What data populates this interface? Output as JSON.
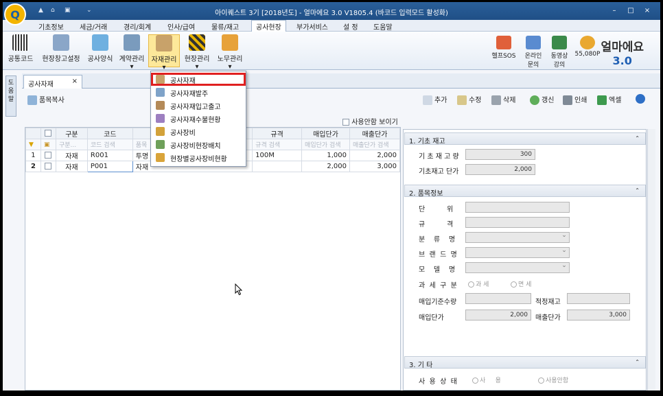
{
  "title": "아이퀘스트 3기 [2018년도] - 얼마에요 3.0 V1805.4 (바코드 입력모드 활성화)",
  "quick_access": [
    "▲",
    "⌂",
    "▣",
    "⌄"
  ],
  "window_buttons": [
    "–",
    "□",
    "×"
  ],
  "menu": [
    "기초정보",
    "세금/거래",
    "경리/회계",
    "인사/급여",
    "물류/재고",
    "공사현장",
    "부가서비스",
    "설 정",
    "도움말"
  ],
  "ribbon": {
    "buttons": [
      "공통코드",
      "현장창고설정",
      "공사양식",
      "계약관리",
      "자재관리",
      "현장관리",
      "노무관리"
    ],
    "arrows": [
      "▾",
      "▾",
      "▾",
      "▾"
    ],
    "right": [
      "헬프SOS",
      "온라인",
      "문의",
      "동영상",
      "강의",
      "55,080P"
    ],
    "brand_line1": "얼마에요",
    "brand_line2": "3.0"
  },
  "sidebar_text": "도움말",
  "doc_tab": {
    "label": "공사자재",
    "close": "×"
  },
  "toolbar": {
    "left": "품목복사",
    "buttons": [
      "추가",
      "수정",
      "삭제",
      "갱신",
      "인쇄",
      "엑셀"
    ]
  },
  "show_unused": "사용안함 보이기",
  "grid": {
    "headers": [
      "",
      "구분",
      "코드",
      "품목",
      "규격",
      "매입단가",
      "매출단가"
    ],
    "filters": [
      "",
      "구분...",
      "코드 검색",
      "품목",
      "규격 검색",
      "매입단가 검색",
      "매출단가 검색"
    ],
    "rows": [
      {
        "no": "1",
        "type": "자재",
        "code": "R001",
        "name": "투명",
        "spec": "100M",
        "buy": "1,000",
        "sell": "2,000"
      },
      {
        "no": "2",
        "type": "자재",
        "code": "P001",
        "name": "자재",
        "spec": "",
        "buy": "2,000",
        "sell": "3,000"
      }
    ]
  },
  "panel": {
    "sec1": "1. 기초 재고",
    "stock_qty_label": "기 초 재 고 량",
    "stock_qty": "300",
    "stock_price_label": "기초재고 단가",
    "stock_price": "2,000",
    "sec2": "2. 품목정보",
    "unit_label": "단          위",
    "spec_label": "규          격",
    "cat_label": "분    류    명",
    "brand_label": "브  랜  드  명",
    "model_label": "모    델    명",
    "tax_label": "과  세  구  분",
    "tax_opt1": "과 세",
    "tax_opt2": "면 세",
    "base_qty_label": "매입기준수량",
    "proper_stock_label": "적정재고",
    "buy_label": "매입단가",
    "buy_price": "2,000",
    "sell_label": "매출단가",
    "sell_price": "3,000",
    "sec3": "3. 기 타",
    "use_label": "사  용  상  태",
    "use_opt1": "사     용",
    "use_opt2": "사용안함",
    "collapse": "⌃"
  },
  "dropdown": [
    "공사자재",
    "공사자재발주",
    "공사자재입고출고",
    "공사자재수불현황",
    "공사장비",
    "공사장비현장배치",
    "현장별공사장비현황"
  ],
  "colors": {
    "title": "#1f4f86",
    "highlight": "#e02020",
    "selected": "#fde89a"
  }
}
